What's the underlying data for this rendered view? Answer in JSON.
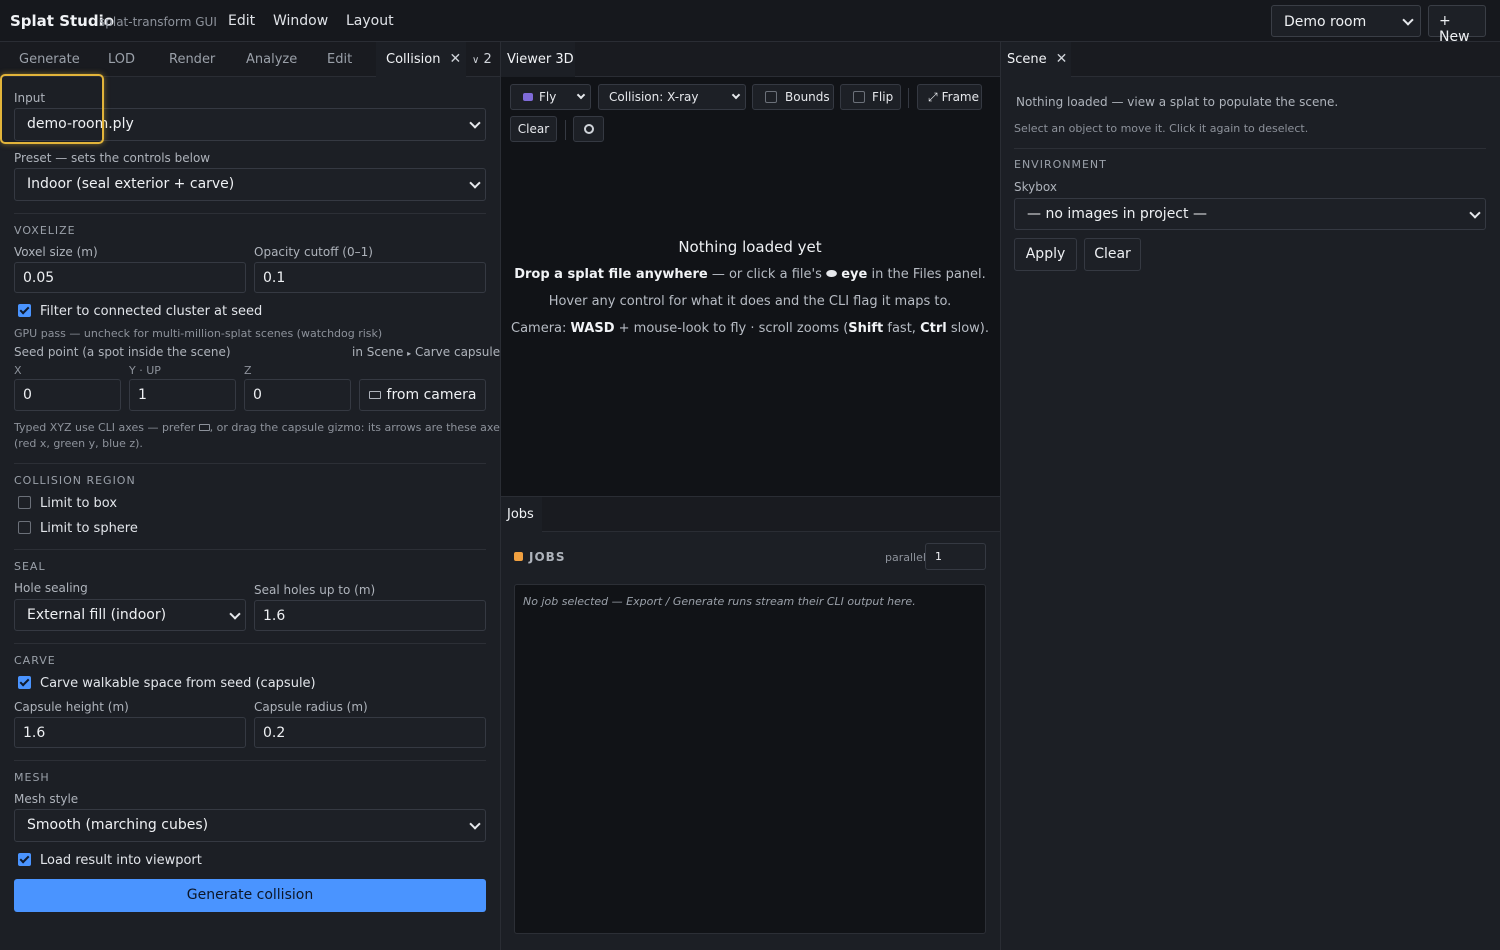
{
  "app": {
    "title": "Splat Studio",
    "subtitle": "splat-transform GUI"
  },
  "menu": [
    "Edit",
    "Window",
    "Layout"
  ],
  "project": {
    "selected": "Demo room",
    "new_label": "+ New"
  },
  "left_tabs": {
    "items": [
      "Generate",
      "LOD",
      "Render",
      "Analyze",
      "Edit",
      "Collision"
    ],
    "active": "Collision",
    "overflow_count": "2"
  },
  "collision": {
    "input_label": "Input",
    "input_value": "demo-room.ply",
    "preset_label": "Preset — sets the controls below",
    "preset_value": "Indoor (seal exterior + carve)",
    "voxelize": {
      "heading": "VOXELIZE",
      "voxel_size_label": "Voxel size (m)",
      "voxel_size": "0.05",
      "opacity_label": "Opacity cutoff (0–1)",
      "opacity": "0.1",
      "filter_label": "Filter to connected cluster at seed",
      "filter_checked": true,
      "gpu_note": "GPU pass — uncheck for multi-million-splat scenes (watchdog risk)",
      "seed_label": "Seed point (a spot inside the scene)",
      "seed_hint_prefix": "in Scene",
      "seed_hint_suffix": "Carve capsule",
      "x_label": "X",
      "x": "0",
      "y_label": "Y · UP",
      "y": "1",
      "z_label": "Z",
      "z": "0",
      "from_camera": "from camera",
      "axes_note_1": "Typed XYZ use CLI axes — prefer",
      "axes_note_1b": ", or drag the capsule gizmo: its arrows are these axes",
      "axes_note_2": "(red x, green y, blue z)."
    },
    "region": {
      "heading": "COLLISION REGION",
      "box_label": "Limit to box",
      "box_checked": false,
      "sphere_label": "Limit to sphere",
      "sphere_checked": false
    },
    "seal": {
      "heading": "SEAL",
      "hole_label": "Hole sealing",
      "hole_value": "External fill (indoor)",
      "holes_up_label": "Seal holes up to (m)",
      "holes_up": "1.6"
    },
    "carve": {
      "heading": "CARVE",
      "carve_label": "Carve walkable space from seed (capsule)",
      "carve_checked": true,
      "height_label": "Capsule height (m)",
      "height": "1.6",
      "radius_label": "Capsule radius (m)",
      "radius": "0.2"
    },
    "mesh": {
      "heading": "MESH",
      "style_label": "Mesh style",
      "style_value": "Smooth (marching cubes)",
      "load_label": "Load result into viewport",
      "load_checked": true
    },
    "generate_label": "Generate collision"
  },
  "viewer": {
    "tab": "Viewer 3D",
    "mode": "Fly",
    "collision": "Collision: X-ray",
    "bounds": "Bounds",
    "flip": "Flip",
    "frame": "Frame",
    "clear": "Clear",
    "empty_title": "Nothing loaded yet",
    "drop_bold": "Drop a splat file anywhere",
    "drop_rest": " — or click a file's ",
    "eye_bold": "eye",
    "drop_end": " in the Files panel.",
    "hover_line": "Hover any control for what it does and the CLI flag it maps to.",
    "cam_1": "Camera: ",
    "cam_wasd": "WASD",
    "cam_2": " + mouse-look to fly · scroll zooms (",
    "cam_shift": "Shift",
    "cam_3": " fast, ",
    "cam_ctrl": "Ctrl",
    "cam_4": " slow)."
  },
  "jobs": {
    "tab": "Jobs",
    "heading": "JOBS",
    "parallel_label": "parallel",
    "parallel_value": "1",
    "empty": "No job selected — Export / Generate runs stream their CLI output here."
  },
  "scene": {
    "tab": "Scene",
    "nothing": "Nothing loaded — view a splat to populate the scene.",
    "hint": "Select an object to move it. Click it again to deselect.",
    "env_heading": "ENVIRONMENT",
    "skybox_label": "Skybox",
    "skybox_value": "— no images in project —",
    "apply": "Apply",
    "clear": "Clear"
  },
  "colors": {
    "accent": "#4a94ff",
    "focus": "#e2b43a",
    "jobs_dot": "#f0a040"
  }
}
